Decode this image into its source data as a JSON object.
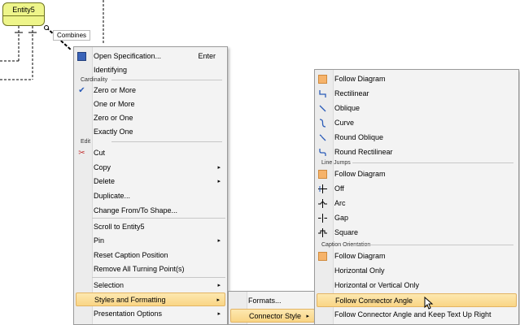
{
  "diagram": {
    "entity_name": "Entity5",
    "connector_caption": "Combines"
  },
  "main_menu": {
    "items": {
      "open_spec": {
        "label": "Open Specification...",
        "shortcut": "Enter"
      },
      "identifying": {
        "label": "Identifying"
      },
      "cardinality_title": "Cardinality",
      "zero_or_more": {
        "label": "Zero or More"
      },
      "one_or_more": {
        "label": "One or More"
      },
      "zero_or_one": {
        "label": "Zero or One"
      },
      "exactly_one": {
        "label": "Exactly One"
      },
      "edit_title": "Edit",
      "cut": {
        "label": "Cut"
      },
      "copy": {
        "label": "Copy"
      },
      "delete": {
        "label": "Delete"
      },
      "duplicate": {
        "label": "Duplicate..."
      },
      "change_from_to": {
        "label": "Change From/To Shape..."
      },
      "scroll_to": {
        "label": "Scroll to Entity5"
      },
      "pin": {
        "label": "Pin"
      },
      "reset_caption": {
        "label": "Reset Caption Position"
      },
      "remove_turning": {
        "label": "Remove All Turning Point(s)"
      },
      "selection": {
        "label": "Selection"
      },
      "styles_formatting": {
        "label": "Styles and Formatting"
      },
      "presentation_options": {
        "label": "Presentation Options"
      }
    },
    "arrow_glyph": "▸"
  },
  "styles_submenu": {
    "formats": "Formats...",
    "connector_style": "Connector Style"
  },
  "connector_style_submenu": {
    "follow_diagram_1": "Follow Diagram",
    "rectilinear": "Rectilinear",
    "oblique": "Oblique",
    "curve": "Curve",
    "round_oblique": "Round Oblique",
    "round_rectilinear": "Round Rectilinear",
    "line_jumps_title": "Line Jumps",
    "follow_diagram_2": "Follow Diagram",
    "off": "Off",
    "arc": "Arc",
    "gap": "Gap",
    "square": "Square",
    "caption_orientation_title": "Caption Orientation",
    "follow_diagram_3": "Follow Diagram",
    "horizontal_only": "Horizontal Only",
    "horizontal_or_vertical": "Horizontal or Vertical Only",
    "follow_connector_angle": "Follow Connector Angle",
    "follow_connector_angle_up": "Follow Connector Angle and Keep Text Up Right"
  },
  "colors": {
    "entity_fill": "#eef58a",
    "highlight": "#f9d585",
    "swatch": "#f6b36a"
  }
}
